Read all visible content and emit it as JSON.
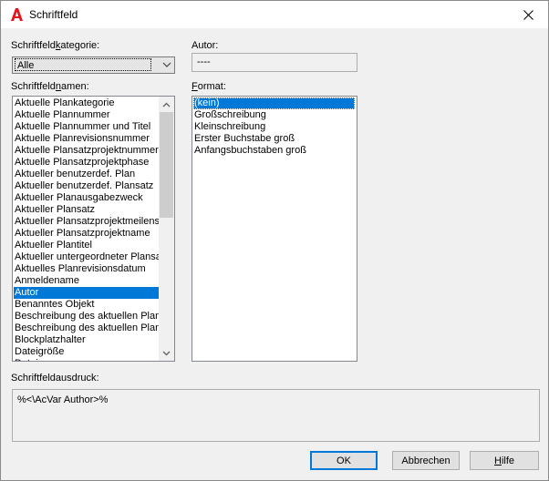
{
  "window": {
    "title": "Schriftfeld",
    "app_icon": "autocad-logo-icon",
    "close_icon": "close-icon"
  },
  "category": {
    "label_prefix": "Schriftfeld",
    "label_underlined": "k",
    "label_suffix": "ategorie:",
    "selected": "Alle"
  },
  "names": {
    "label_prefix": "Schriftfeld",
    "label_underlined": "n",
    "label_suffix": "amen:",
    "items": [
      "Aktuelle Plankategorie",
      "Aktuelle Plannummer",
      "Aktuelle Plannummer und Titel",
      "Aktuelle Planrevisionsnummer",
      "Aktuelle Plansatzprojektnummer",
      "Aktuelle Plansatzprojektphase",
      "Aktueller benutzerdef. Plan",
      "Aktueller benutzerdef. Plansatz",
      "Aktueller Planausgabezweck",
      "Aktueller Plansatz",
      "Aktueller Plansatzprojektmeilenst",
      "Aktueller Plansatzprojektname",
      "Aktueller Plantitel",
      "Aktueller untergeordneter Plansa",
      "Aktuelles Planrevisionsdatum",
      "Anmeldename",
      "Autor",
      "Benanntes Objekt",
      "Beschreibung des aktuellen Plans",
      "Beschreibung des aktuellen Plans",
      "Blockplatzhalter",
      "Dateigröße",
      "Datei"
    ],
    "selected_index": 16
  },
  "author": {
    "label": "Autor:",
    "value": "----"
  },
  "format": {
    "label_prefix": "",
    "label_underlined": "F",
    "label_suffix": "ormat:",
    "items": [
      "(kein)",
      "Großschreibung",
      "Kleinschreibung",
      "Erster Buchstabe groß",
      "Anfangsbuchstaben groß"
    ],
    "selected_index": 0
  },
  "expression": {
    "label": "Schriftfeldausdruck:",
    "value": "%<\\AcVar Author>%"
  },
  "buttons": {
    "ok": "OK",
    "cancel": "Abbrechen",
    "help_underlined": "H",
    "help_rest": "ilfe"
  }
}
